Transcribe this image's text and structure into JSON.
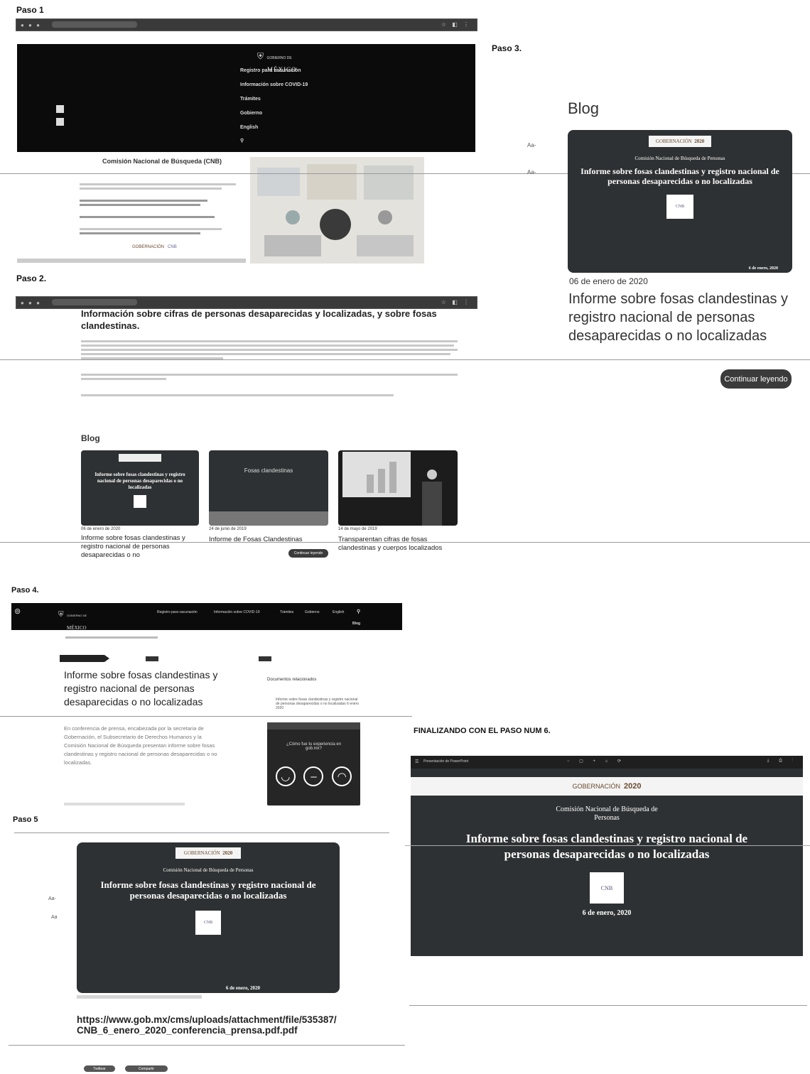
{
  "steps": {
    "paso1": "Paso 1",
    "paso2": "Paso 2.",
    "paso3": "Paso 3.",
    "paso4": "Paso 4.",
    "paso5": "Paso 5",
    "final": "FINALIZANDO CON EL PASO NUM 6."
  },
  "gob_logo": {
    "line1": "GOBIERNO DE",
    "line2": "MÉXICO"
  },
  "step1": {
    "menu": [
      "Registro para vacunación",
      "Información sobre COVID-19",
      "Trámites",
      "Gobierno",
      "English"
    ],
    "cnb_title": "Comisión Nacional de Búsqueda (CNB)",
    "gobernacion": "GOBERNACIÓN",
    "cnb": "CNB"
  },
  "step2": {
    "heading": "Información sobre cifras de personas desaparecidas y localizadas, y sobre fosas clandestinas.",
    "blog_title": "Blog",
    "cards": [
      {
        "date": "06 de enero de 2020",
        "title": "Informe sobre fosas clandestinas y registro nacional de personas desaparecidas o no",
        "thumb_text": "Informe sobre fosas clandestinas y registro nacional de personas desaparecidas o no localizadas"
      },
      {
        "date": "24 de junio de 2019",
        "title": "Informe de Fosas Clandestinas",
        "thumb_text": "Fosas clandestinas",
        "button": "Continuar leyendo"
      },
      {
        "date": "14 de mayo de 2019",
        "title": "Transparentan cifras de fosas clandestinas y cuerpos localizados"
      }
    ]
  },
  "step3": {
    "blog_title": "Blog",
    "aa": "Aa-",
    "card": {
      "gobernacion": "GOBERNACIÓN",
      "year": "2020",
      "subtitle": "Comisión Nacional de Búsqueda de Personas",
      "title": "Informe sobre fosas clandestinas y registro nacional de personas desaparecidas o no localizadas",
      "cnb": "CNB",
      "date": "6 de enero, 2020"
    },
    "date": "06 de enero de 2020",
    "title": "Informe sobre fosas clandestinas y registro nacional de personas desaparecidas o no localizadas",
    "button": "Continuar leyendo"
  },
  "step4": {
    "nav": [
      "Registro para vacunación",
      "Información sobre COVID-19",
      "Trámites",
      "Gobierno",
      "English"
    ],
    "blog": "Blog",
    "title": "Informe sobre fosas clandestinas y registro nacional de personas desaparecidas o no localizadas",
    "body": "En conferencia de prensa, encabezada por la secretaria de Gobernación, el Subsecretario de Derechos Humanos y la Comisión Nacional de Búsqueda presentan informe sobre fosas clandestinas y registro nacional de personas desaparecidas o no localizadas.",
    "related": "Documentos relacionados",
    "related_doc": "Informe sobre fosas clandestinas y registro nacional de personas desaparecidas o no localizadas 6 enero 2020",
    "survey_q": "¿Cómo fue tu experiencia en gob.mx?"
  },
  "step5": {
    "card": {
      "gobernacion": "GOBERNACIÓN",
      "year": "2020",
      "subtitle": "Comisión Nacional de Búsqueda de Personas",
      "title": "Informe sobre fosas clandestinas y registro nacional de personas desaparecidas o no localizadas",
      "cnb": "CNB",
      "date": "6 de enero, 2020"
    },
    "aa1": "Aa-",
    "aa2": "Aa",
    "url": "https://www.gob.mx/cms/uploads/attachment/file/535387/CNB_6_enero_2020_conferencia_prensa.pdf.pdf",
    "share1": "Twittear",
    "share2": "Compartir"
  },
  "step6": {
    "toolbar_title": "Presentación de PowerPoint",
    "gobernacion": "GOBERNACIÓN",
    "year": "2020",
    "subtitle": "Comisión Nacional de Búsqueda de Personas",
    "title": "Informe sobre fosas clandestinas y registro nacional de personas desaparecidas o no localizadas",
    "cnb": "CNB",
    "date": "6 de enero, 2020"
  }
}
